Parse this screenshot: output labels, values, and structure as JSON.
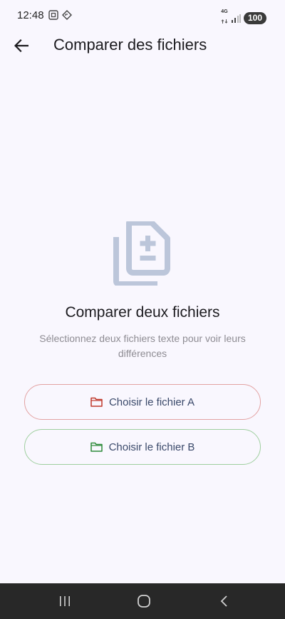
{
  "status_bar": {
    "time": "12:48",
    "network": "4G",
    "battery": "100"
  },
  "app_bar": {
    "title": "Comparer des fichiers",
    "back_icon": "arrow-left-icon"
  },
  "empty_state": {
    "icon": "file-diff-icon",
    "icon_color": "#bcc6da",
    "title": "Comparer deux fichiers",
    "subtitle": "Sélectionnez deux fichiers texte pour voir leurs différences"
  },
  "buttons": {
    "file_a": {
      "label": "Choisir le fichier A",
      "icon": "folder-icon",
      "color": "#c0392b"
    },
    "file_b": {
      "label": "Choisir le fichier B",
      "icon": "folder-icon",
      "color": "#2e8b3a"
    }
  },
  "colors": {
    "background": "#f9f7fe",
    "nav_bar": "#282828"
  }
}
